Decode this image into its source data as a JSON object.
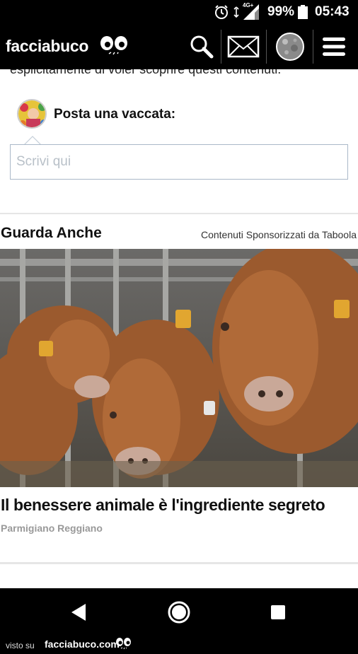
{
  "status_bar": {
    "network_label": "4G+",
    "battery_percent": "99%",
    "time": "05:43"
  },
  "header": {
    "logo_text": "facciabuco",
    "icons": [
      "search-icon",
      "mail-icon",
      "profile-avatar-icon",
      "menu-icon"
    ]
  },
  "content": {
    "cut_off_text": "esplicitamente di voler scoprire questi contenuti.",
    "post_prompt": "Posta una vaccata:",
    "comment_placeholder": "Scrivi qui",
    "section_title": "Guarda Anche",
    "sponsor_text": "Contenuti Sponsorizzati da Taboola",
    "article": {
      "title": "Il benessere animale è l'ingrediente segreto",
      "source": "Parmigiano Reggiano"
    }
  },
  "nav_bar": {
    "icons": [
      "back-icon",
      "home-icon",
      "recents-icon"
    ]
  },
  "watermark": {
    "prefix": "visto su",
    "site": "facciabuco.com"
  }
}
